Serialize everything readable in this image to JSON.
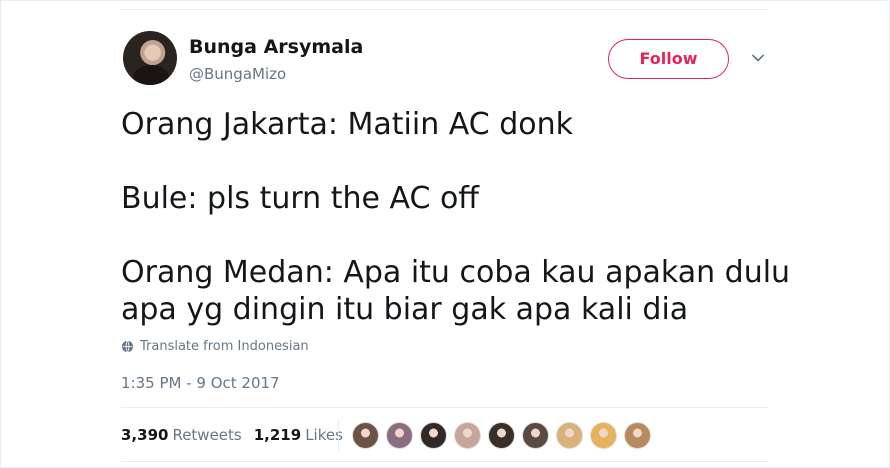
{
  "tweet": {
    "author_name": "Bunga Arsymala",
    "author_handle": "@BungaMizo",
    "follow_label": "Follow",
    "text": "Orang Jakarta: Matiin AC donk\n\nBule: pls turn the AC off\n\nOrang Medan: Apa itu coba kau apakan dulu apa yg dingin itu biar gak apa kali dia",
    "translate_label": "Translate from Indonesian",
    "timestamp": "1:35 PM - 9 Oct 2017",
    "retweets_count": "3,390",
    "retweets_label": "Retweets",
    "likes_count": "1,219",
    "likes_label": "Likes"
  },
  "colors": {
    "follow_accent": "#e0245e",
    "secondary_text": "#657786",
    "likers": [
      "#6b5346",
      "#8a6e80",
      "#2f2a27",
      "#c7a59b",
      "#3a2e2a",
      "#5a4a43",
      "#d8b27a",
      "#e4b35c",
      "#b88a5e"
    ]
  },
  "icons": {
    "chevron": "chevron-down-icon",
    "translate": "globe-icon"
  }
}
